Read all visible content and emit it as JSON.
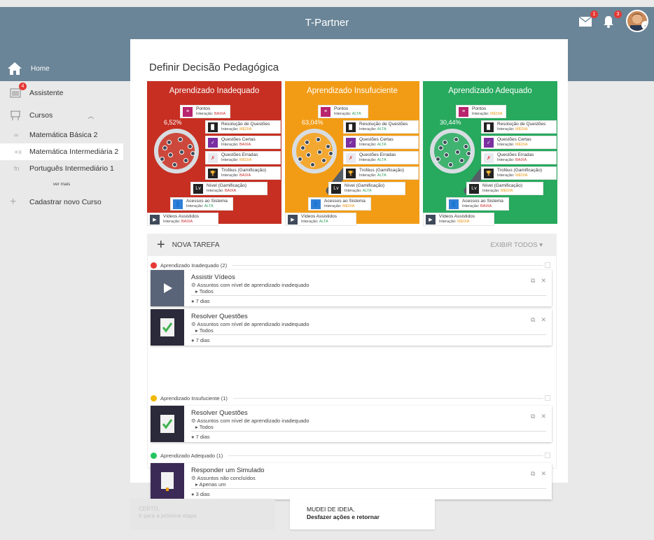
{
  "app": {
    "title": "T-Partner"
  },
  "header": {
    "messages_count": "1",
    "notifications_count": "3"
  },
  "sidebar": {
    "home": "Home",
    "assistant": "Assistente",
    "assistant_badge": "4",
    "courses": "Cursos",
    "course_list": [
      "Matemática Básica 2",
      "Matemática Intermediária 2",
      "Português Intermediário 1"
    ],
    "more": "ver mais",
    "add_course": "Cadastrar novo Curso"
  },
  "page": {
    "title": "Definir Decisão Pedagógica"
  },
  "panels": [
    {
      "title": "Aprendizado Inadequado",
      "percent": "6,52%",
      "color": "#c62f22",
      "items": [
        {
          "label": "Pontos",
          "level": "BAIXA"
        },
        {
          "label": "Resolução de Questões",
          "level": "MÉDIA"
        },
        {
          "label": "Questões Certas",
          "level": "BAIXA"
        },
        {
          "label": "Questões Erradas",
          "level": "MÉDIA"
        },
        {
          "label": "Troféus (Gamificação)",
          "level": "BAIXA"
        },
        {
          "label": "Nível (Gamificação)",
          "level": "BAIXA"
        },
        {
          "label": "Acessos ao Sistema",
          "level": "ALTA"
        },
        {
          "label": "Vídeos Assistidos",
          "level": "BAIXA"
        }
      ]
    },
    {
      "title": "Aprendizado Insufuciente",
      "percent": "63,04%",
      "color": "#f29c16",
      "items": [
        {
          "label": "Pontos",
          "level": "ALTA"
        },
        {
          "label": "Resolução de Questões",
          "level": "ALTA"
        },
        {
          "label": "Questões Certas",
          "level": "ALTA"
        },
        {
          "label": "Questões Erradas",
          "level": "ALTA"
        },
        {
          "label": "Troféus (Gamificação)",
          "level": "ALTA"
        },
        {
          "label": "Nível (Gamificação)",
          "level": "ALTA"
        },
        {
          "label": "Acessos ao Sistema",
          "level": "MÉDIA"
        },
        {
          "label": "Vídeos Assistidos",
          "level": "ALTA"
        }
      ]
    },
    {
      "title": "Aprendizado Adequado",
      "percent": "30,44%",
      "color": "#27a95e",
      "items": [
        {
          "label": "Pontos",
          "level": "MÉDIA"
        },
        {
          "label": "Resolução de Questões",
          "level": "MÉDIA"
        },
        {
          "label": "Questões Certas",
          "level": "MÉDIA"
        },
        {
          "label": "Questões Erradas",
          "level": "BAIXA"
        },
        {
          "label": "Troféus (Gamificação)",
          "level": "MÉDIA"
        },
        {
          "label": "Nível (Gamificação)",
          "level": "MÉDIA"
        },
        {
          "label": "Acessos ao Sistema",
          "level": "BAIXA"
        },
        {
          "label": "Vídeos Assistidos",
          "level": "MÉDIA"
        }
      ]
    }
  ],
  "interaction_prefix": "Interação:",
  "tasks": {
    "new_task": "NOVA TAREFA",
    "show_all": "EXIBIR TODOS",
    "groups": [
      {
        "title": "Aprendizado Inadequado (2)",
        "color": "#e53935",
        "items": [
          {
            "name": "Assistir Vídeos",
            "subject": "Assuntos com nível de aprendizado inadequado",
            "scope": "Todos",
            "days": "7 dias"
          },
          {
            "name": "Resolver Questões",
            "subject": "Assuntos com nível de aprendizado inadequado",
            "scope": "Todos",
            "days": "7 dias"
          }
        ]
      },
      {
        "title": "Aprendizado Insufuciente (1)",
        "color": "#f5b800",
        "items": [
          {
            "name": "Resolver Questões",
            "subject": "Assuntos com nível de aprendizado inadequado",
            "scope": "Todos",
            "days": "7 dias"
          }
        ]
      },
      {
        "title": "Aprendizado Adequado (1)",
        "color": "#22c55e",
        "items": [
          {
            "name": "Responder um Simulado",
            "subject": "Assuntos não concluídos",
            "scope": "Apenas um",
            "days": "3 dias"
          }
        ]
      }
    ]
  },
  "footer": {
    "next_line1": "CERTO,",
    "next_line2": "Ir para a próxima etapa",
    "undo_line1": "MUDEI DE IDEIA,",
    "undo_line2": "Desfazer ações e retornar"
  }
}
